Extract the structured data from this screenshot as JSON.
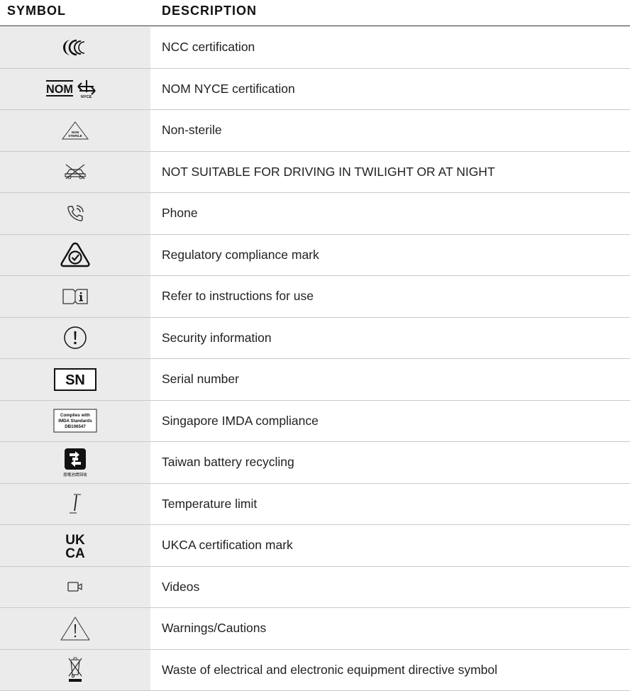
{
  "header": {
    "symbol_label": "SYMBOL",
    "description_label": "DESCRIPTION"
  },
  "rows": [
    {
      "icon": "ncc-certification-icon",
      "description": "NCC certification"
    },
    {
      "icon": "nom-nyce-certification-icon",
      "description": "NOM NYCE certification",
      "icon_text": {
        "nom": "NOM",
        "nyce": "NYCE"
      }
    },
    {
      "icon": "non-sterile-icon",
      "description": "Non-sterile",
      "icon_text": {
        "line1": "NON",
        "line2": "STERILE"
      }
    },
    {
      "icon": "no-night-driving-icon",
      "description": "NOT SUITABLE FOR DRIVING IN TWILIGHT OR AT NIGHT"
    },
    {
      "icon": "phone-icon",
      "description": "Phone"
    },
    {
      "icon": "regulatory-compliance-mark-icon",
      "description": "Regulatory compliance mark"
    },
    {
      "icon": "instructions-for-use-icon",
      "description": "Refer to instructions for use"
    },
    {
      "icon": "security-information-icon",
      "description": "Security information"
    },
    {
      "icon": "serial-number-icon",
      "description": "Serial number",
      "icon_text": "SN"
    },
    {
      "icon": "singapore-imda-icon",
      "description": "Singapore IMDA compliance",
      "icon_text": {
        "line1": "Complies with",
        "line2": "IMDA Standards",
        "line3": "DB106547"
      }
    },
    {
      "icon": "taiwan-battery-recycling-icon",
      "description": "Taiwan battery recycling",
      "icon_text": "廢電池請回收"
    },
    {
      "icon": "temperature-limit-icon",
      "description": "Temperature limit"
    },
    {
      "icon": "ukca-mark-icon",
      "description": "UKCA certification mark",
      "icon_text": {
        "line1": "UK",
        "line2": "CA"
      }
    },
    {
      "icon": "video-camera-icon",
      "description": "Videos"
    },
    {
      "icon": "warning-triangle-icon",
      "description": "Warnings/Cautions"
    },
    {
      "icon": "weee-crossed-bin-icon",
      "description": "Waste of electrical and electronic equipment directive symbol"
    }
  ]
}
